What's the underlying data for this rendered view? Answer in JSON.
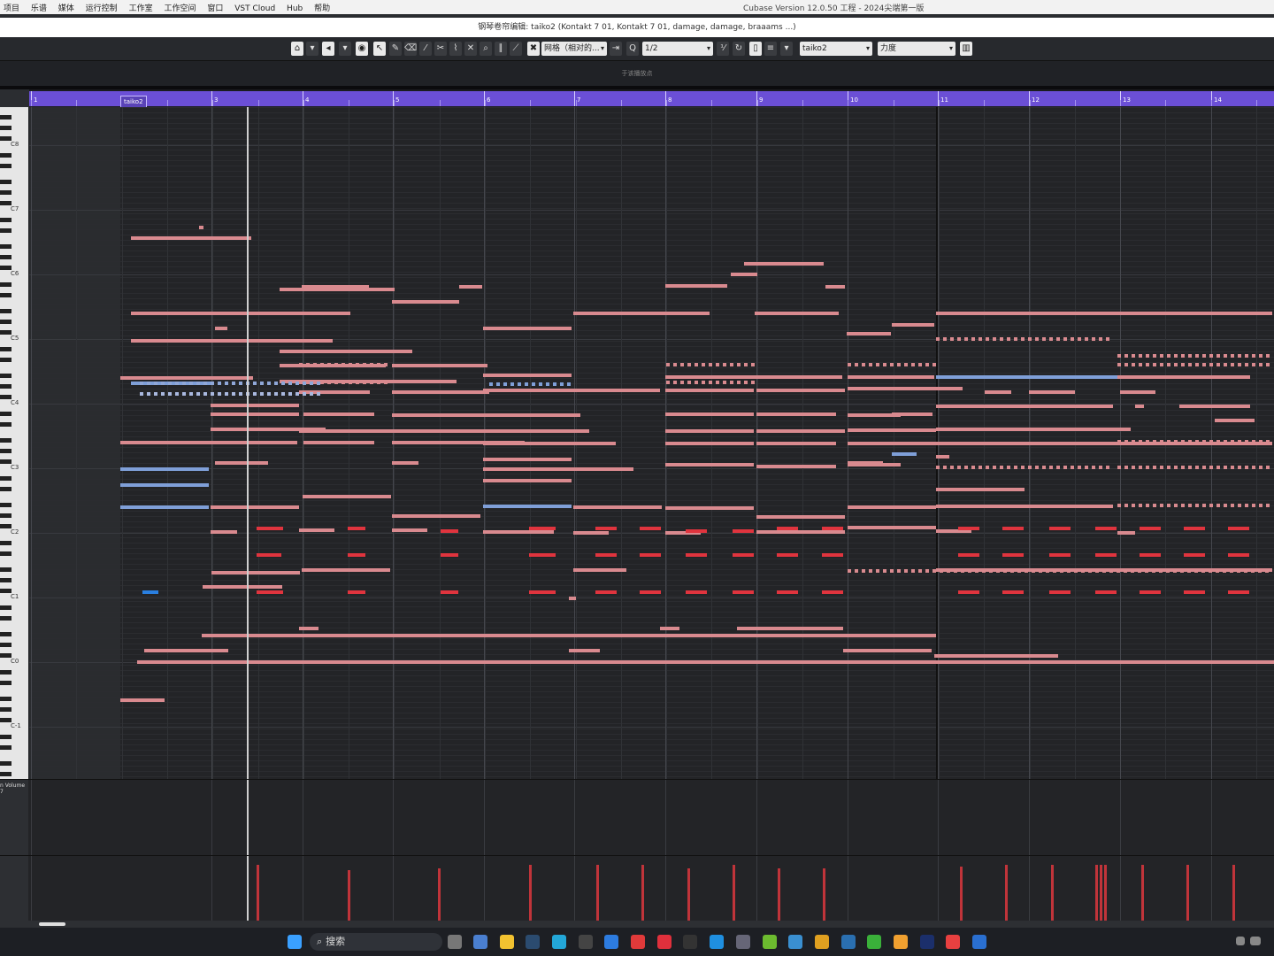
{
  "menubar": {
    "items": [
      "项目",
      "乐谱",
      "媒体",
      "运行控制",
      "工作室",
      "工作空间",
      "窗口",
      "VST Cloud",
      "Hub",
      "帮助"
    ],
    "app_title": "Cubase Version 12.0.50 工程 - 2024尖端第一版"
  },
  "editor": {
    "title": "钢琴卷帘编辑: taiko2 (Kontakt 7 01, Kontakt 7 01, damage, damage, braaams ...)",
    "info_line": "于该播放点"
  },
  "toolbar": {
    "grid_label": "网格（相对的...",
    "quantize_value": "1/2",
    "track_select": "taiko2",
    "controller_select": "力度"
  },
  "ruler": {
    "region_label": "taiko2",
    "bars": [
      "1",
      "3",
      "4",
      "5",
      "6",
      "7",
      "8",
      "9",
      "10",
      "11",
      "12",
      "13",
      "14"
    ]
  },
  "keyboard": {
    "octave_labels": [
      "C8",
      "C7",
      "C6",
      "C5",
      "C4",
      "C3",
      "C2",
      "C1",
      "C0",
      "C-1"
    ]
  },
  "controller_lanes": {
    "lane1_label": "n Volume",
    "lane1_value": "7"
  },
  "taskbar": {
    "search_placeholder": "搜索"
  },
  "colors": {
    "accent_ruler": "#6b4fd6",
    "note_pink": "#d98a8f",
    "note_red": "#e0343e",
    "note_blue": "#7f9fd8",
    "velocity": "#c0343a"
  }
}
